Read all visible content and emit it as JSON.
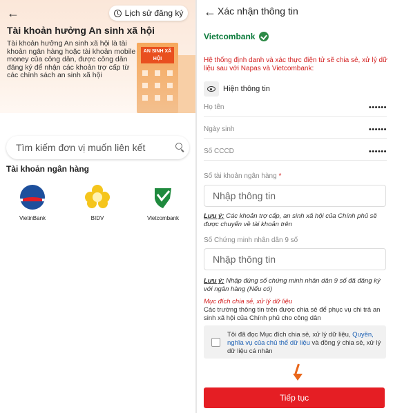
{
  "left": {
    "history_label": "Lịch sử đăng ký",
    "title": "Tài khoản hưởng An sinh xã hội",
    "description": "Tài khoản hưởng An sinh xã hội là tài khoản ngân hàng hoặc tài khoản mobile money của công dân, được công dân đăng ký để nhận các khoản trợ cấp từ các chính sách an sinh xã hội",
    "illustration_sign": "AN SINH XÃ HỘI",
    "search_placeholder": "Tìm kiếm đơn vị muốn liên kết",
    "section_title": "Tài khoản ngân hàng",
    "banks": [
      {
        "name": "VietinBank"
      },
      {
        "name": "BIDV"
      },
      {
        "name": "Vietcombank"
      }
    ]
  },
  "right": {
    "title": "Xác nhận thông tin",
    "bank_name": "Vietcombank",
    "warning": "Hệ thống định danh và xác thực điện tử sẽ chia sẻ, xử lý dữ liệu sau với Napas và Vietcombank:",
    "show_info_label": "Hiện thông tin",
    "fields": [
      {
        "label": "Họ tên",
        "value": "••••••"
      },
      {
        "label": "Ngày sinh",
        "value": "••••••"
      },
      {
        "label": "Số CCCD",
        "value": "••••••"
      }
    ],
    "account_label": "Số tài khoản ngân hàng",
    "required_mark": "*",
    "account_placeholder": "Nhập thông tin",
    "note1_prefix": "Lưu ý:",
    "note1_text": " Các khoản trợ cấp, an sinh xã hội của Chính phủ sẽ được chuyển về tài khoản trên",
    "id9_label": "Số Chứng minh nhân dân 9 số",
    "id9_placeholder": "Nhập thông tin",
    "note2_prefix": "Lưu ý:",
    "note2_text": " Nhập đúng số chứng minh nhân dân 9 số đã đăng ký với ngân hàng (Nếu có)",
    "purpose_title": "Mục đích chia sẻ, xử lý dữ liệu",
    "purpose_desc": "Các trường thông tin trên được chia sẻ để phục vụ chi trả an sinh xã hội của Chính phủ cho công dân",
    "consent_pre": "Tôi đã đọc Mục đích chia sẻ, xử lý dữ liệu, ",
    "consent_link": "Quyền, nghĩa vụ của chủ thể dữ liệu",
    "consent_post": " và đồng ý chia sẻ, xử lý dữ liệu cá nhân",
    "submit_label": "Tiếp tục"
  },
  "colors": {
    "brand_red": "#e51e24",
    "vcb_green": "#0a7a3a",
    "link_blue": "#1a5fb4",
    "hero_bg": "#fbe7d9"
  }
}
